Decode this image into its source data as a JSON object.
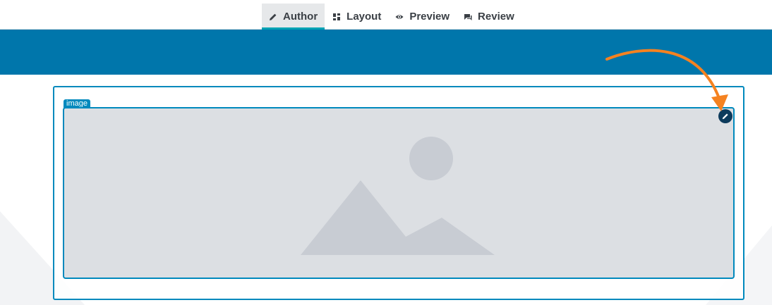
{
  "tabs": [
    {
      "label": "Author",
      "icon": "pencil-icon",
      "active": true
    },
    {
      "label": "Layout",
      "icon": "grid-icon",
      "active": false
    },
    {
      "label": "Preview",
      "icon": "eye-icon",
      "active": false
    },
    {
      "label": "Review",
      "icon": "comment-icon",
      "active": false
    }
  ],
  "image_component": {
    "tag_label": "image",
    "placeholder_icon": "image-placeholder-icon",
    "edit_icon": "pencil-icon"
  },
  "colors": {
    "banner": "#0076ab",
    "accent": "#0089bd",
    "active_tab_underline": "#00a3b4",
    "placeholder_bg": "#dcdfe3",
    "placeholder_shapes": "#c8ccd3",
    "edit_button": "#0d3b5c",
    "annotation_arrow": "#f58220"
  }
}
